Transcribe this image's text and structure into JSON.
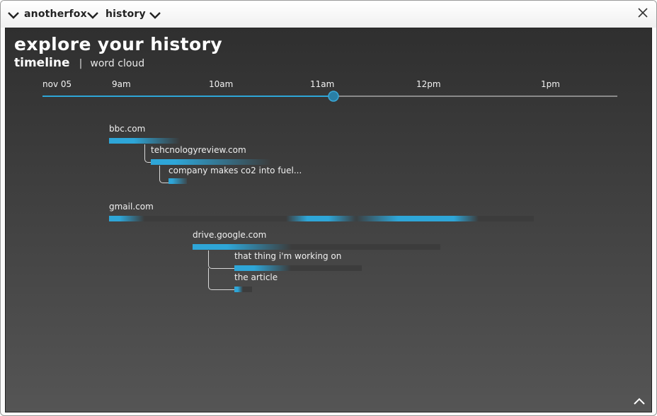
{
  "titlebar": {
    "app_label": "anotherfox",
    "menu_label": "history"
  },
  "page": {
    "heading": "explore your history",
    "tabs": {
      "active": "timeline",
      "separator": "|",
      "other": "word cloud"
    }
  },
  "timeline": {
    "date_label": "nov 05",
    "ticks": [
      "9am",
      "10am",
      "11am",
      "12pm",
      "1pm"
    ],
    "current_position_label": "11am"
  },
  "history": {
    "bbc": {
      "site": "bbc.com",
      "child_site": "tehcnologyreview.com",
      "child_page": "company makes co2 into fuel..."
    },
    "gmail": {
      "site": "gmail.com"
    },
    "drive": {
      "site": "drive.google.com",
      "page_1": "that thing i'm working on",
      "page_2": "the article"
    }
  },
  "colors": {
    "accent": "#2ea6d8",
    "panel_top": "#2f2f2f",
    "panel_bottom": "#555555",
    "track": "#3c3c3c"
  }
}
